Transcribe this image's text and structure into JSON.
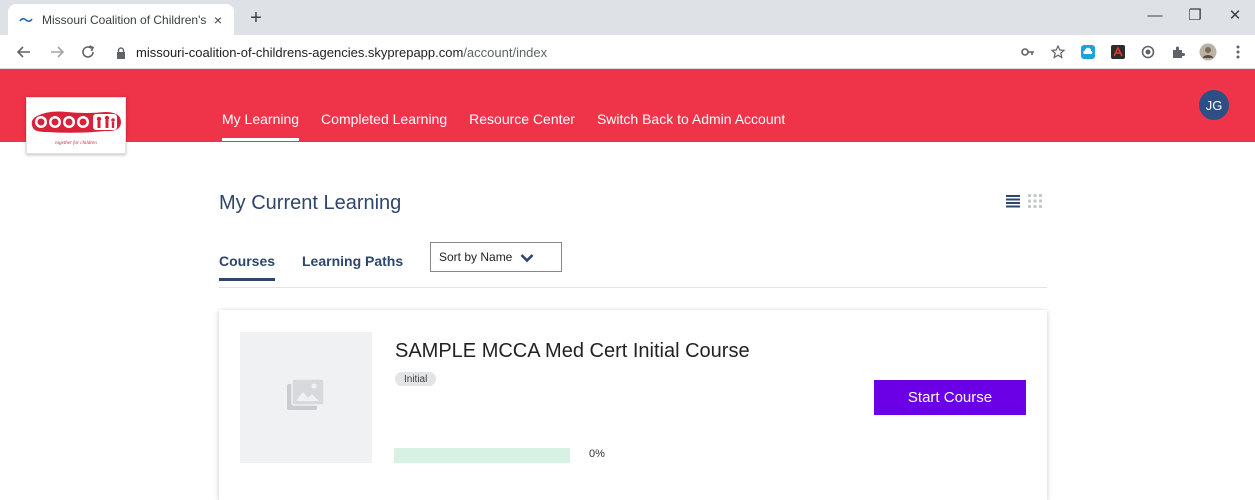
{
  "browser": {
    "tab_title": "Missouri Coalition of Children's A",
    "tab_close": "×",
    "new_tab": "+",
    "url_host": "missouri-coalition-of-childrens-agencies.skyprepapp.com",
    "url_path": "/account/index",
    "win_minimize": "—",
    "win_restore": "❐",
    "win_close": "✕",
    "icons": [
      "key-icon",
      "star-icon",
      "cloud-extension-icon",
      "pdf-extension-icon",
      "circle-extension-icon",
      "puzzle-icon",
      "profile-icon",
      "menu-dots-icon"
    ]
  },
  "header": {
    "background": "#ef3349",
    "nav": [
      "My Learning",
      "Completed Learning",
      "Resource Center",
      "Switch Back to Admin Account"
    ],
    "active_nav": "My Learning",
    "avatar_initials": "JG",
    "logo_text": "mcca",
    "logo_tagline": "together for children"
  },
  "main": {
    "title": "My Current Learning",
    "tabs": [
      "Courses",
      "Learning Paths"
    ],
    "active_tab": "Courses",
    "sort_label": "Sort by Name",
    "courses": [
      {
        "title": "SAMPLE MCCA Med Cert Initial Course",
        "badge": "Initial",
        "action": "Start Course",
        "progress": 0,
        "progress_label": "0%"
      }
    ]
  },
  "colors": {
    "accent": "#6b00e6",
    "title_text": "#2e466b",
    "avatar": "#2d4f86",
    "progress_track": "#d7f2e5"
  }
}
